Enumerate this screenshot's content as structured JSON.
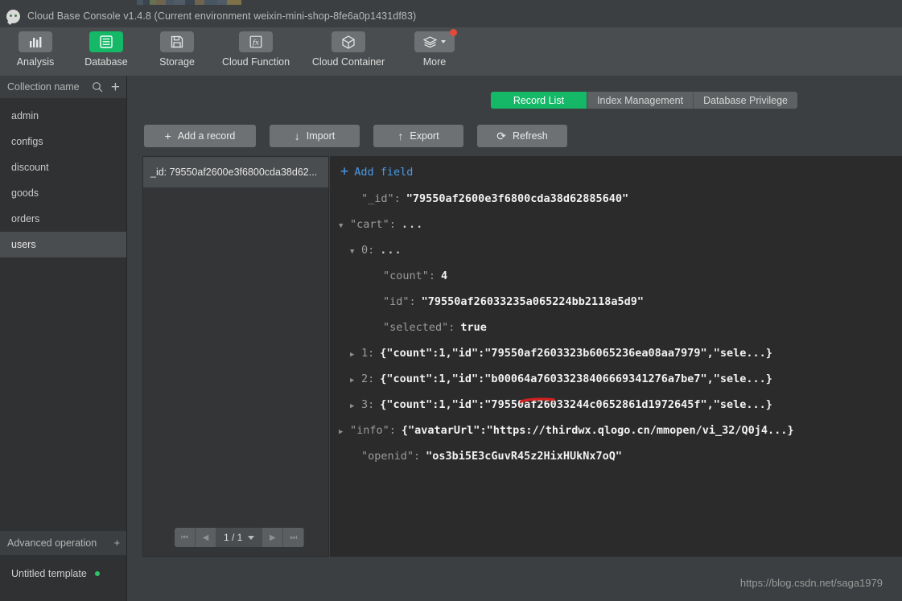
{
  "window": {
    "title": "Cloud Base Console v1.4.8 (Current environment weixin-mini-shop-8fe6a0p1431df83)",
    "logo_icon": "wechat-cloud-logo"
  },
  "toolbar": {
    "items": [
      {
        "label": "Analysis",
        "icon": "bar-chart-icon",
        "active": false
      },
      {
        "label": "Database",
        "icon": "database-list-icon",
        "active": true
      },
      {
        "label": "Storage",
        "icon": "floppy-disk-icon",
        "active": false
      },
      {
        "label": "Cloud Function",
        "icon": "fx-icon",
        "active": false
      },
      {
        "label": "Cloud Container",
        "icon": "cube-icon",
        "active": false
      },
      {
        "label": "More",
        "icon": "layers-icon",
        "active": false,
        "has_caret": true,
        "has_badge": true
      }
    ]
  },
  "sidebar": {
    "header_label": "Collection name",
    "search_icon": "search-icon",
    "add_icon": "plus-icon",
    "items": [
      {
        "label": "admin",
        "selected": false
      },
      {
        "label": "configs",
        "selected": false
      },
      {
        "label": "discount",
        "selected": false
      },
      {
        "label": "goods",
        "selected": false
      },
      {
        "label": "orders",
        "selected": false
      },
      {
        "label": "users",
        "selected": true
      }
    ],
    "footer_label": "Advanced operation",
    "footer_add_icon": "plus-icon",
    "template_label": "Untitled template",
    "template_status_dot": "#2fc46a"
  },
  "tabs": [
    {
      "label": "Record List",
      "active": true
    },
    {
      "label": "Index Management",
      "active": false
    },
    {
      "label": "Database Privilege",
      "active": false
    }
  ],
  "actions": [
    {
      "label": "Add a record",
      "icon": "plus-icon",
      "glyph": "+"
    },
    {
      "label": "Import",
      "icon": "download-icon",
      "glyph": "⤓"
    },
    {
      "label": "Export",
      "icon": "upload-icon",
      "glyph": "⤒"
    },
    {
      "label": "Refresh",
      "icon": "refresh-icon",
      "glyph": "⟳"
    }
  ],
  "record_list": {
    "items": [
      {
        "label": "_id: 79550af2600e3f6800cda38d62...",
        "selected": true
      }
    ],
    "pagination": {
      "first_icon": "first-page-icon",
      "prev_icon": "prev-page-icon",
      "next_icon": "next-page-icon",
      "last_icon": "last-page-icon",
      "page_text": "1 / 1",
      "caret_icon": "chevron-down-icon"
    }
  },
  "viewer": {
    "add_field_label": "Add field",
    "add_field_icon": "plus-icon",
    "rows": [
      {
        "indent": 1,
        "tri": "",
        "key": "\"_id\":",
        "value": "\"79550af2600e3f6800cda38d62885640\"",
        "kind": "string"
      },
      {
        "indent": 0,
        "tri": "▼",
        "key": "\"cart\":",
        "value": "...",
        "kind": "dots"
      },
      {
        "indent": 1,
        "tri": "▼",
        "key": "0:",
        "value": "...",
        "kind": "dots"
      },
      {
        "indent": 2,
        "tri": "",
        "key": "\"count\":",
        "value": "4",
        "kind": "number"
      },
      {
        "indent": 2,
        "tri": "",
        "key": "\"id\":",
        "value": "\"79550af26033235a065224bb2118a5d9\"",
        "kind": "string",
        "annotated": true
      },
      {
        "indent": 2,
        "tri": "",
        "key": "\"selected\":",
        "value": "true",
        "kind": "bool"
      },
      {
        "indent": 1,
        "tri": "▶",
        "key": "1:",
        "value": "{\"count\":1,\"id\":\"79550af2603323b6065236ea08aa7979\",\"sele...}",
        "kind": "string"
      },
      {
        "indent": 1,
        "tri": "▶",
        "key": "2:",
        "value": "{\"count\":1,\"id\":\"b00064a76033238406669341276a7be7\",\"sele...}",
        "kind": "string"
      },
      {
        "indent": 1,
        "tri": "▶",
        "key": "3:",
        "value": "{\"count\":1,\"id\":\"79550af26033244c0652861d1972645f\",\"sele...}",
        "kind": "string"
      },
      {
        "indent": 0,
        "tri": "▶",
        "key": "\"info\":",
        "value": "{\"avatarUrl\":\"https://thirdwx.qlogo.cn/mmopen/vi_32/Q0j4...}",
        "kind": "string"
      },
      {
        "indent": 1,
        "tri": "",
        "key": "\"openid\":",
        "value": "\"os3bi5E3cGuvR45z2HixHUkNx7oQ\"",
        "kind": "string"
      }
    ],
    "annotation_color": "#d32020"
  },
  "watermark": "https://blog.csdn.net/saga1979"
}
